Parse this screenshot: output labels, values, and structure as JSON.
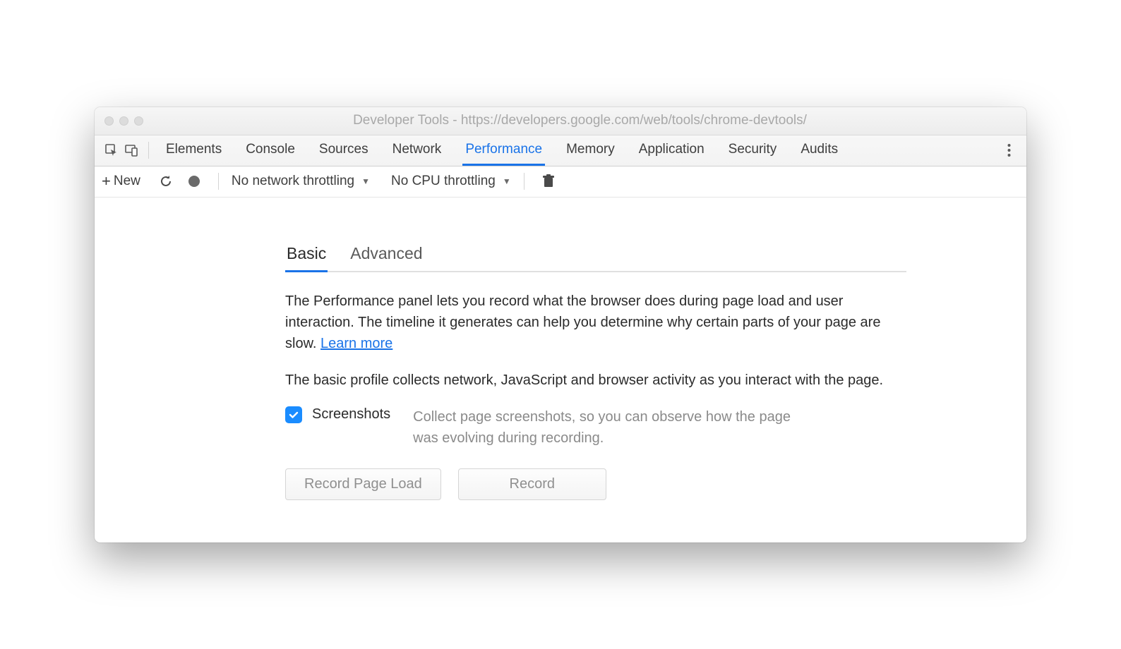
{
  "window": {
    "title": "Developer Tools - https://developers.google.com/web/tools/chrome-devtools/"
  },
  "tabs": [
    {
      "label": "Elements",
      "active": false
    },
    {
      "label": "Console",
      "active": false
    },
    {
      "label": "Sources",
      "active": false
    },
    {
      "label": "Network",
      "active": false
    },
    {
      "label": "Performance",
      "active": true
    },
    {
      "label": "Memory",
      "active": false
    },
    {
      "label": "Application",
      "active": false
    },
    {
      "label": "Security",
      "active": false
    },
    {
      "label": "Audits",
      "active": false
    }
  ],
  "toolbar": {
    "new_label": "New",
    "network_throttle": "No network throttling",
    "cpu_throttle": "No CPU throttling"
  },
  "subtabs": [
    {
      "label": "Basic",
      "active": true
    },
    {
      "label": "Advanced",
      "active": false
    }
  ],
  "content": {
    "intro": "The Performance panel lets you record what the browser does during page load and user interaction. The timeline it generates can help you determine why certain parts of your page are slow.  ",
    "learn_more": "Learn more",
    "basic_desc": "The basic profile collects network, JavaScript and browser activity as you interact with the page.",
    "screenshots_label": "Screenshots",
    "screenshots_desc": "Collect page screenshots, so you can observe how the page was evolving during recording.",
    "btn_record_page_load": "Record Page Load",
    "btn_record": "Record"
  }
}
